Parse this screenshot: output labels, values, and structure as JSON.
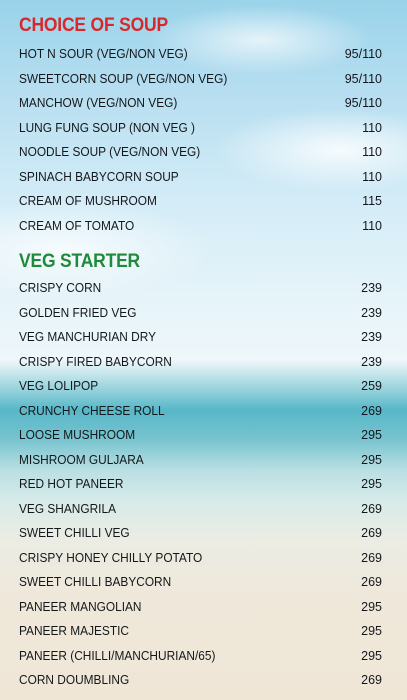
{
  "sections": {
    "soup": {
      "title": "CHOICE OF SOUP",
      "items": [
        {
          "name": "HOT N SOUR (VEG/NON VEG)",
          "price": "95/110"
        },
        {
          "name": "SWEETCORN SOUP (VEG/NON VEG)",
          "price": "95/110"
        },
        {
          "name": "MANCHOW (VEG/NON VEG)",
          "price": "95/110"
        },
        {
          "name": "LUNG FUNG SOUP (NON VEG )",
          "price": "110"
        },
        {
          "name": "NOODLE SOUP (VEG/NON VEG)",
          "price": "110"
        },
        {
          "name": "SPINACH BABYCORN SOUP",
          "price": "110"
        },
        {
          "name": "CREAM OF MUSHROOM",
          "price": "115"
        },
        {
          "name": "CREAM OF TOMATO",
          "price": "110"
        }
      ]
    },
    "veg_starter": {
      "title": "VEG STARTER",
      "items": [
        {
          "name": "CRISPY CORN",
          "price": "239"
        },
        {
          "name": "GOLDEN FRIED VEG",
          "price": "239"
        },
        {
          "name": "VEG MANCHURIAN DRY",
          "price": "239"
        },
        {
          "name": "CRISPY FIRED BABYCORN",
          "price": "239"
        },
        {
          "name": "VEG LOLIPOP",
          "price": "259"
        },
        {
          "name": "CRUNCHY CHEESE ROLL",
          "price": "269"
        },
        {
          "name": "LOOSE MUSHROOM",
          "price": "295"
        },
        {
          "name": "MISHROOM GULJARA",
          "price": "295"
        },
        {
          "name": "RED HOT PANEER",
          "price": "295"
        },
        {
          "name": "VEG SHANGRILA",
          "price": "269"
        },
        {
          "name": "SWEET CHILLI VEG",
          "price": "269"
        },
        {
          "name": "CRISPY HONEY CHILLY POTATO",
          "price": "269"
        },
        {
          "name": "SWEET CHILLI BABYCORN",
          "price": "269"
        },
        {
          "name": "PANEER MANGOLIAN",
          "price": "295"
        },
        {
          "name": "PANEER MAJESTIC",
          "price": "295"
        },
        {
          "name": "PANEER (CHILLI/MANCHURIAN/65)",
          "price": "295"
        },
        {
          "name": "CORN DOUMBLING",
          "price": "269"
        }
      ]
    }
  },
  "colors": {
    "soup_title": "#d8282c",
    "veg_title": "#1e8a3a",
    "item_text": "#14181c"
  }
}
